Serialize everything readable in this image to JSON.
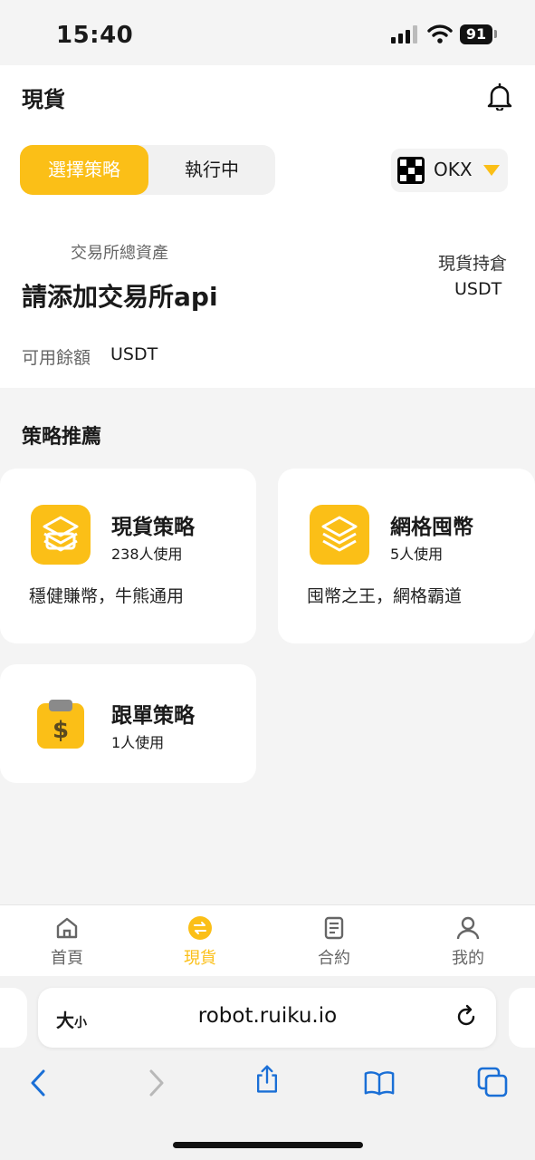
{
  "status_bar": {
    "time": "15:40",
    "battery": "91"
  },
  "header": {
    "title": "現貨"
  },
  "segment": {
    "active": "選擇策略",
    "inactive": "執行中"
  },
  "exchange": {
    "label": "OKX"
  },
  "assets": {
    "total_label": "交易所總資產",
    "total_value": "請添加交易所api",
    "holding_label": "現貨持倉",
    "holding_unit": "USDT",
    "available_label": "可用餘額",
    "available_unit": "USDT"
  },
  "recommend": {
    "title": "策略推薦",
    "cards": [
      {
        "title": "現貨策略",
        "users": "238人使用",
        "desc": "穩健賺幣，牛熊通用"
      },
      {
        "title": "網格囤幣",
        "users": "5人使用",
        "desc": "囤幣之王，網格霸道"
      },
      {
        "title": "跟單策略",
        "users": "1人使用"
      }
    ]
  },
  "tabbar": {
    "items": [
      {
        "label": "首頁"
      },
      {
        "label": "現貨"
      },
      {
        "label": "合約"
      },
      {
        "label": "我的"
      }
    ]
  },
  "browser": {
    "text_size": "大",
    "text_size_small": "小",
    "url": "robot.ruiku.io"
  },
  "colors": {
    "accent": "#fbbf17",
    "background": "#f4f4f4",
    "card": "#ffffff"
  }
}
